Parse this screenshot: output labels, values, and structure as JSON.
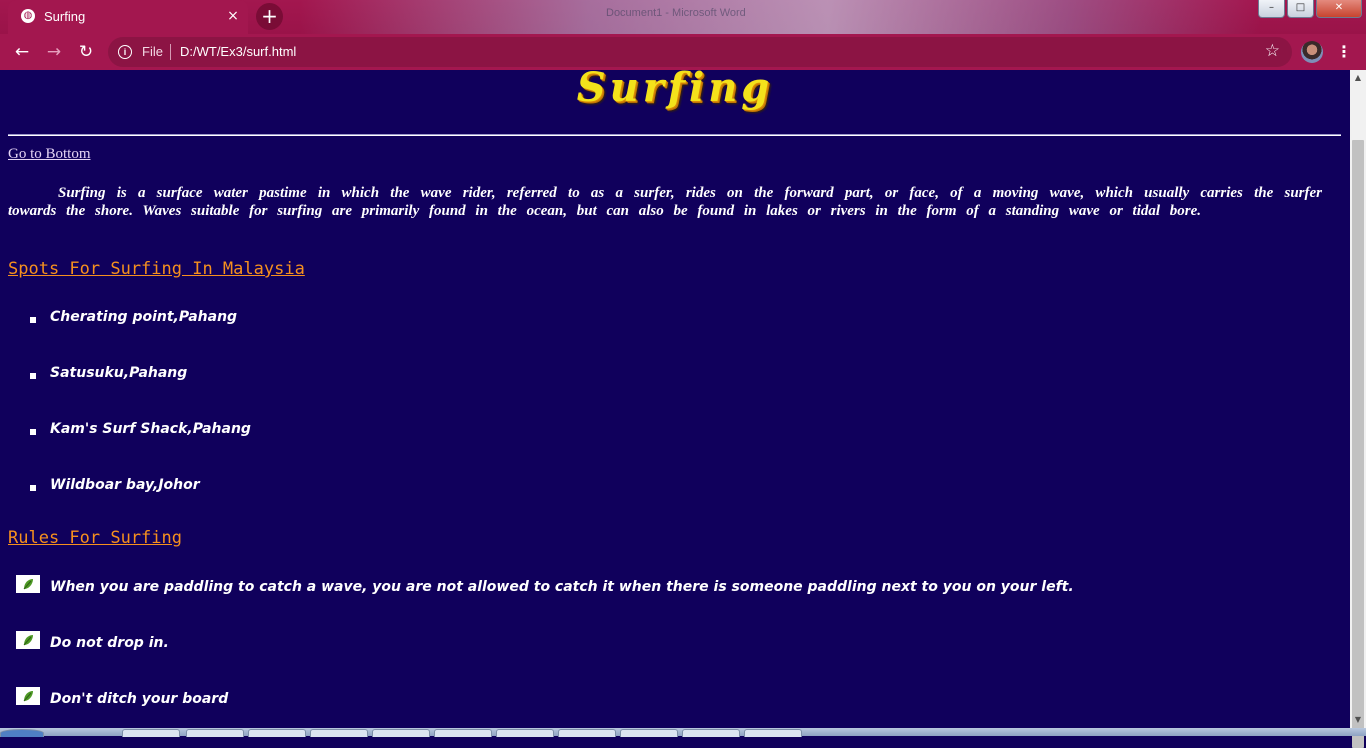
{
  "browser": {
    "tab_title": "Surfing",
    "tab_close": "×",
    "new_tab": "+",
    "background_window_title": "Document1 - Microsoft Word",
    "window_buttons": {
      "minimize": "–",
      "maximize": "□",
      "close": "✕"
    },
    "back": "←",
    "forward": "→",
    "reload": "↻",
    "info": "i",
    "scheme": "File",
    "url": "D:/WT/Ex3/surf.html",
    "bookmark": "☆",
    "menu": "⋮",
    "accent_color": "#a3174f"
  },
  "page": {
    "title": "Surfing",
    "go_to_bottom": "Go to Bottom",
    "intro": "Surfing is a surface water pastime in which the wave rider, referred to as a surfer, rides on the forward part, or face, of a moving wave, which usually carries the surfer towards the shore. Waves suitable for surfing are primarily found in the ocean, but can also be found in lakes or rivers in the form of a standing wave or tidal bore.",
    "spots_heading": "Spots For Surfing In Malaysia",
    "spots": [
      "Cherating point,Pahang",
      "Satusuku,Pahang",
      "Kam's Surf Shack,Pahang",
      "Wildboar bay,Johor"
    ],
    "rules_heading": "Rules For Surfing",
    "rules": [
      "When you are paddling to catch a wave, you are not allowed to catch it when there is someone paddling next to you on your left.",
      "Do not drop in.",
      "Don't ditch your board"
    ],
    "background_color": "#10005c",
    "title_color": "#f4e21b",
    "heading_color": "#f6901e"
  },
  "scrollbar": {
    "up": "▲",
    "down": "▼"
  }
}
